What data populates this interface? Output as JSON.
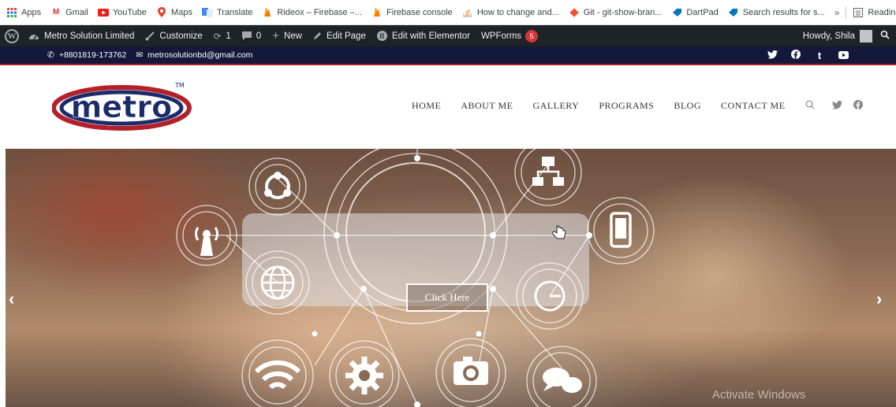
{
  "bookmarks": {
    "items": [
      {
        "label": "Apps",
        "icon": "apps-icon"
      },
      {
        "label": "Gmail",
        "icon": "gmail-icon"
      },
      {
        "label": "YouTube",
        "icon": "youtube-icon"
      },
      {
        "label": "Maps",
        "icon": "maps-icon"
      },
      {
        "label": "Translate",
        "icon": "translate-icon"
      },
      {
        "label": "Rideox – Firebase –...",
        "icon": "firebase-icon"
      },
      {
        "label": "Firebase console",
        "icon": "firebase-icon"
      },
      {
        "label": "How to change and...",
        "icon": "stackoverflow-icon"
      },
      {
        "label": "Git - git-show-bran...",
        "icon": "git-icon"
      },
      {
        "label": "DartPad",
        "icon": "dartpad-icon"
      },
      {
        "label": "Search results for s...",
        "icon": "search-results-icon"
      }
    ],
    "more": "»",
    "reading_list": "Reading list"
  },
  "adminbar": {
    "site_name": "Metro Solution Limited",
    "customize": "Customize",
    "updates_count": "1",
    "comments_count": "0",
    "new_label": "New",
    "edit_page": "Edit Page",
    "elementor": "Edit with Elementor",
    "wpforms": "WPForms",
    "wpforms_badge": "5",
    "howdy": "Howdy, Shila"
  },
  "topbar": {
    "phone": "+8801819-173762",
    "email": "metrosolutionbd@gmail.com"
  },
  "header": {
    "logo_text": "metro",
    "logo_tm": "TM",
    "nav": [
      "HOME",
      "ABOUT ME",
      "GALLERY",
      "PROGRAMS",
      "BLOG",
      "CONTACT ME"
    ]
  },
  "hero": {
    "cta_label": "Click Here",
    "prev": "‹",
    "next": "›",
    "watermark": "Activate Windows"
  },
  "colors": {
    "admin_bg": "#1d2327",
    "topbar_bg": "#14183a",
    "accent_red": "#b3202a",
    "logo_navy": "#1b2a6b"
  }
}
